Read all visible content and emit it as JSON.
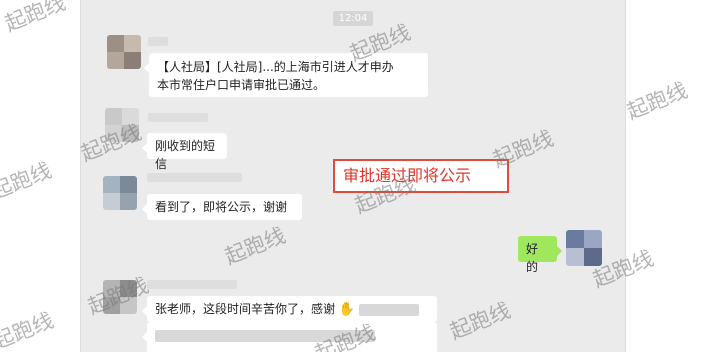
{
  "chat": {
    "timestamp": "12:04",
    "messages": [
      {
        "side": "left",
        "text_lines": [
          "【人社局】[人社局]...的上海市引进人才申办",
          "本市常住户口申请审批已通过。"
        ]
      },
      {
        "side": "left",
        "text": "刚收到的短信"
      },
      {
        "side": "left",
        "text": "看到了，即将公示，谢谢"
      },
      {
        "side": "right",
        "text": "好的"
      },
      {
        "side": "left",
        "text": "张老师，这段时间辛苦你了，感谢"
      }
    ]
  },
  "annotation": {
    "text": "审批通过即将公示",
    "color": "#e0352b"
  },
  "watermark": {
    "text": "起跑线"
  },
  "colors": {
    "background": "#ebebeb",
    "bubble_self": "#9fe85e",
    "bubble_other": "#ffffff",
    "accent_red": "#e24a3b"
  },
  "icons": [
    "avatar",
    "avatar",
    "avatar",
    "avatar",
    "avatar",
    "muscle-emoji-icon"
  ]
}
